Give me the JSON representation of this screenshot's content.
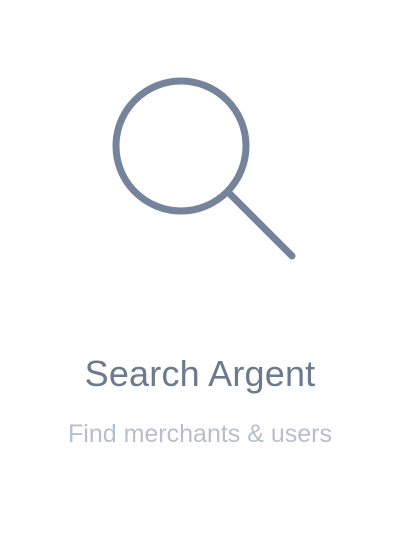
{
  "empty_state": {
    "icon": "search-icon",
    "title": "Search Argent",
    "subtitle": "Find merchants & users"
  },
  "colors": {
    "icon": "#75849a",
    "title": "#6b7a8d",
    "subtitle": "#b6bfcb",
    "background": "#ffffff"
  }
}
